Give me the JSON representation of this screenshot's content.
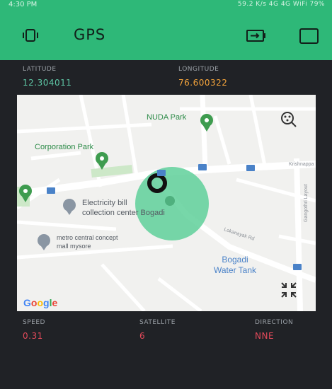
{
  "status_bar": {
    "time": "4:30 PM",
    "indicators": "59.2 K/s  4G  4G  WiFi  79%"
  },
  "header": {
    "title": "GPS",
    "left_icon": "device-icon",
    "right_icons": [
      "battery-icon",
      "square-icon"
    ]
  },
  "coords": {
    "latitude_label": "LATITUDE",
    "latitude_value": "12.304011",
    "longitude_label": "LONGITUDE",
    "longitude_value": "76.600322"
  },
  "map": {
    "places": {
      "park1": "NUDA Park",
      "park2": "Corporation Park",
      "poi1_line1": "Electricity bill",
      "poi1_line2": "collection center Bogadi",
      "poi2_line1": "metro central concept",
      "poi2_line2": "mall mysore",
      "water_line1": "Bogadi",
      "water_line2": "Water Tank",
      "road1": "Krishnappa Rd",
      "road2": "Lokanayak Rd",
      "road3": "Gangothri Layout"
    },
    "logo": [
      "G",
      "o",
      "o",
      "g",
      "l",
      "e"
    ]
  },
  "info": {
    "speed_label": "SPEED",
    "speed_value": "0.31",
    "satellite_label": "SATELLITE",
    "satellite_value": "6",
    "direction_label": "DIRECTION",
    "direction_value": "NNE"
  },
  "colors": {
    "accent": "#2eb878",
    "latitude": "#5ec6a5",
    "longitude": "#f3a33b",
    "info_value": "#e24a5a",
    "background": "#202226"
  }
}
